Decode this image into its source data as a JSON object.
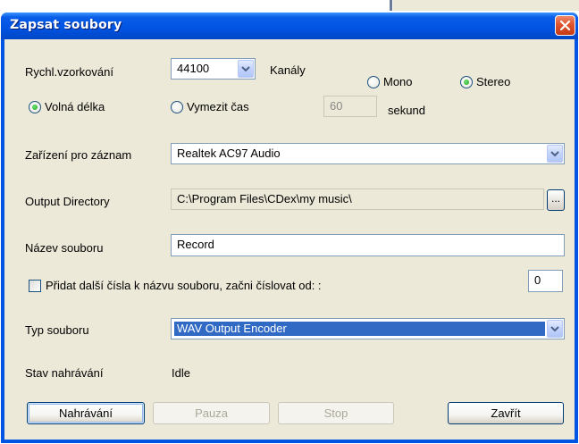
{
  "window": {
    "title": "Zapsat soubory"
  },
  "sample_rate": {
    "label": "Rychl.vzorkování",
    "value": "44100"
  },
  "channels": {
    "label": "Kanály",
    "options": [
      {
        "label": "Mono",
        "selected": false
      },
      {
        "label": "Stereo",
        "selected": true
      }
    ]
  },
  "length": {
    "free_label": "Volná délka",
    "free_selected": true,
    "limit_label": "Vymezit čas",
    "limit_selected": false,
    "seconds_value": "60",
    "seconds_unit": "sekund"
  },
  "device": {
    "label": "Zařízení pro záznam",
    "value": "Realtek AC97 Audio"
  },
  "output_dir": {
    "label": "Output Directory",
    "value": "C:\\Program Files\\CDex\\my music\\",
    "browse_label": "..."
  },
  "filename": {
    "label": "Název souboru",
    "value": "Record"
  },
  "numbering": {
    "label": "Přidat další čísla k názvu souboru, začni číslovat od: :",
    "checked": false,
    "start_value": "0"
  },
  "file_type": {
    "label": "Typ souboru",
    "value": "WAV Output Encoder"
  },
  "status": {
    "label": "Stav nahrávání",
    "value": "Idle"
  },
  "buttons": {
    "record": "Nahrávání",
    "pause": "Pauza",
    "stop": "Stop",
    "close": "Zavřít"
  },
  "colors": {
    "titlebar": "#0054e3",
    "close_button": "#e0552d",
    "dialog_bg": "#ece9d8",
    "selection": "#316ac5"
  }
}
